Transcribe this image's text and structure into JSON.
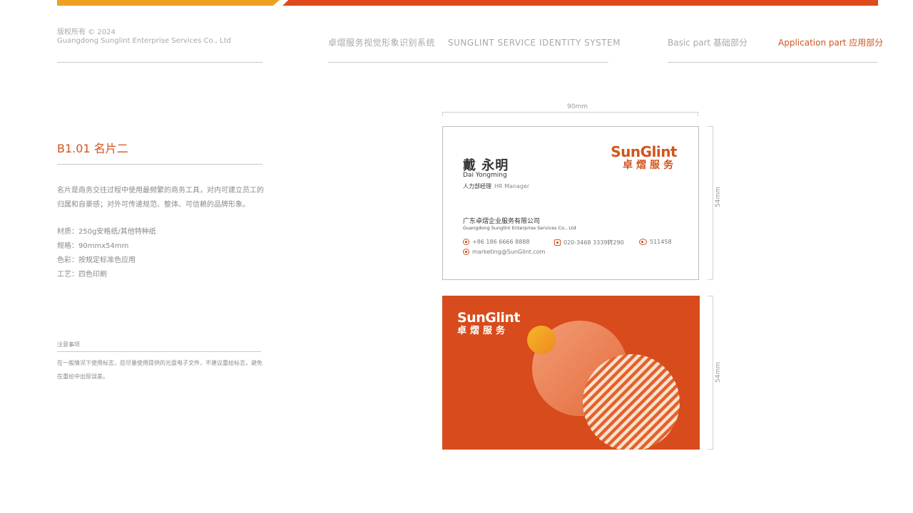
{
  "header": {
    "copyright": "版权所有 © 2024",
    "company": "Guangdong Sunglint Enterprise Services Co., Ltd",
    "system_cn": "卓熠服务视觉形象识别系统",
    "system_en": "SUNGLINT SERVICE IDENTITY SYSTEM",
    "nav_basic": "Basic part 基础部分",
    "nav_application": "Application part 应用部分"
  },
  "section": {
    "title": "B1.01 名片二",
    "description": "名片是商务交往过程中使用最频繁的商务工具，对内可建立员工的归属和自豪感；对外可传递规范、整体、可信赖的品牌形象。",
    "specs": [
      "材质：250g安格纸/其他特种纸",
      "规格：90mmx54mm",
      "色彩：按规定标准色应用",
      "工艺：四色印刷"
    ],
    "note_title": "注意事项",
    "note_text": "在一般情况下使用标志，应尽量使用提供的光盘电子文件，不建议重绘标志，避免在重绘中出现误差。"
  },
  "dimensions": {
    "width_label": "90mm",
    "height_label_front": "54mm",
    "height_label_back": "54mm"
  },
  "card_front": {
    "name": "戴 永明",
    "name_en": "Dai Yongming",
    "title_cn": "人力部经理",
    "title_en": "HR Manager",
    "company_cn": "广东卓熠企业服务有限公司",
    "company_en": "Guangdong Sunglint Enterprise Services Co., Ltd",
    "mobile": "+86 186 6666 8888",
    "phone": "020-3468 3339转290",
    "postcode": "511458",
    "email": "marketing@SunGlint.com"
  },
  "logo": {
    "en": "SunGlint",
    "cn": "卓熠服务"
  },
  "colors": {
    "brand_orange": "#d84b1c",
    "accent_yellow": "#f0a020",
    "text_gray": "#8a8a8a"
  }
}
